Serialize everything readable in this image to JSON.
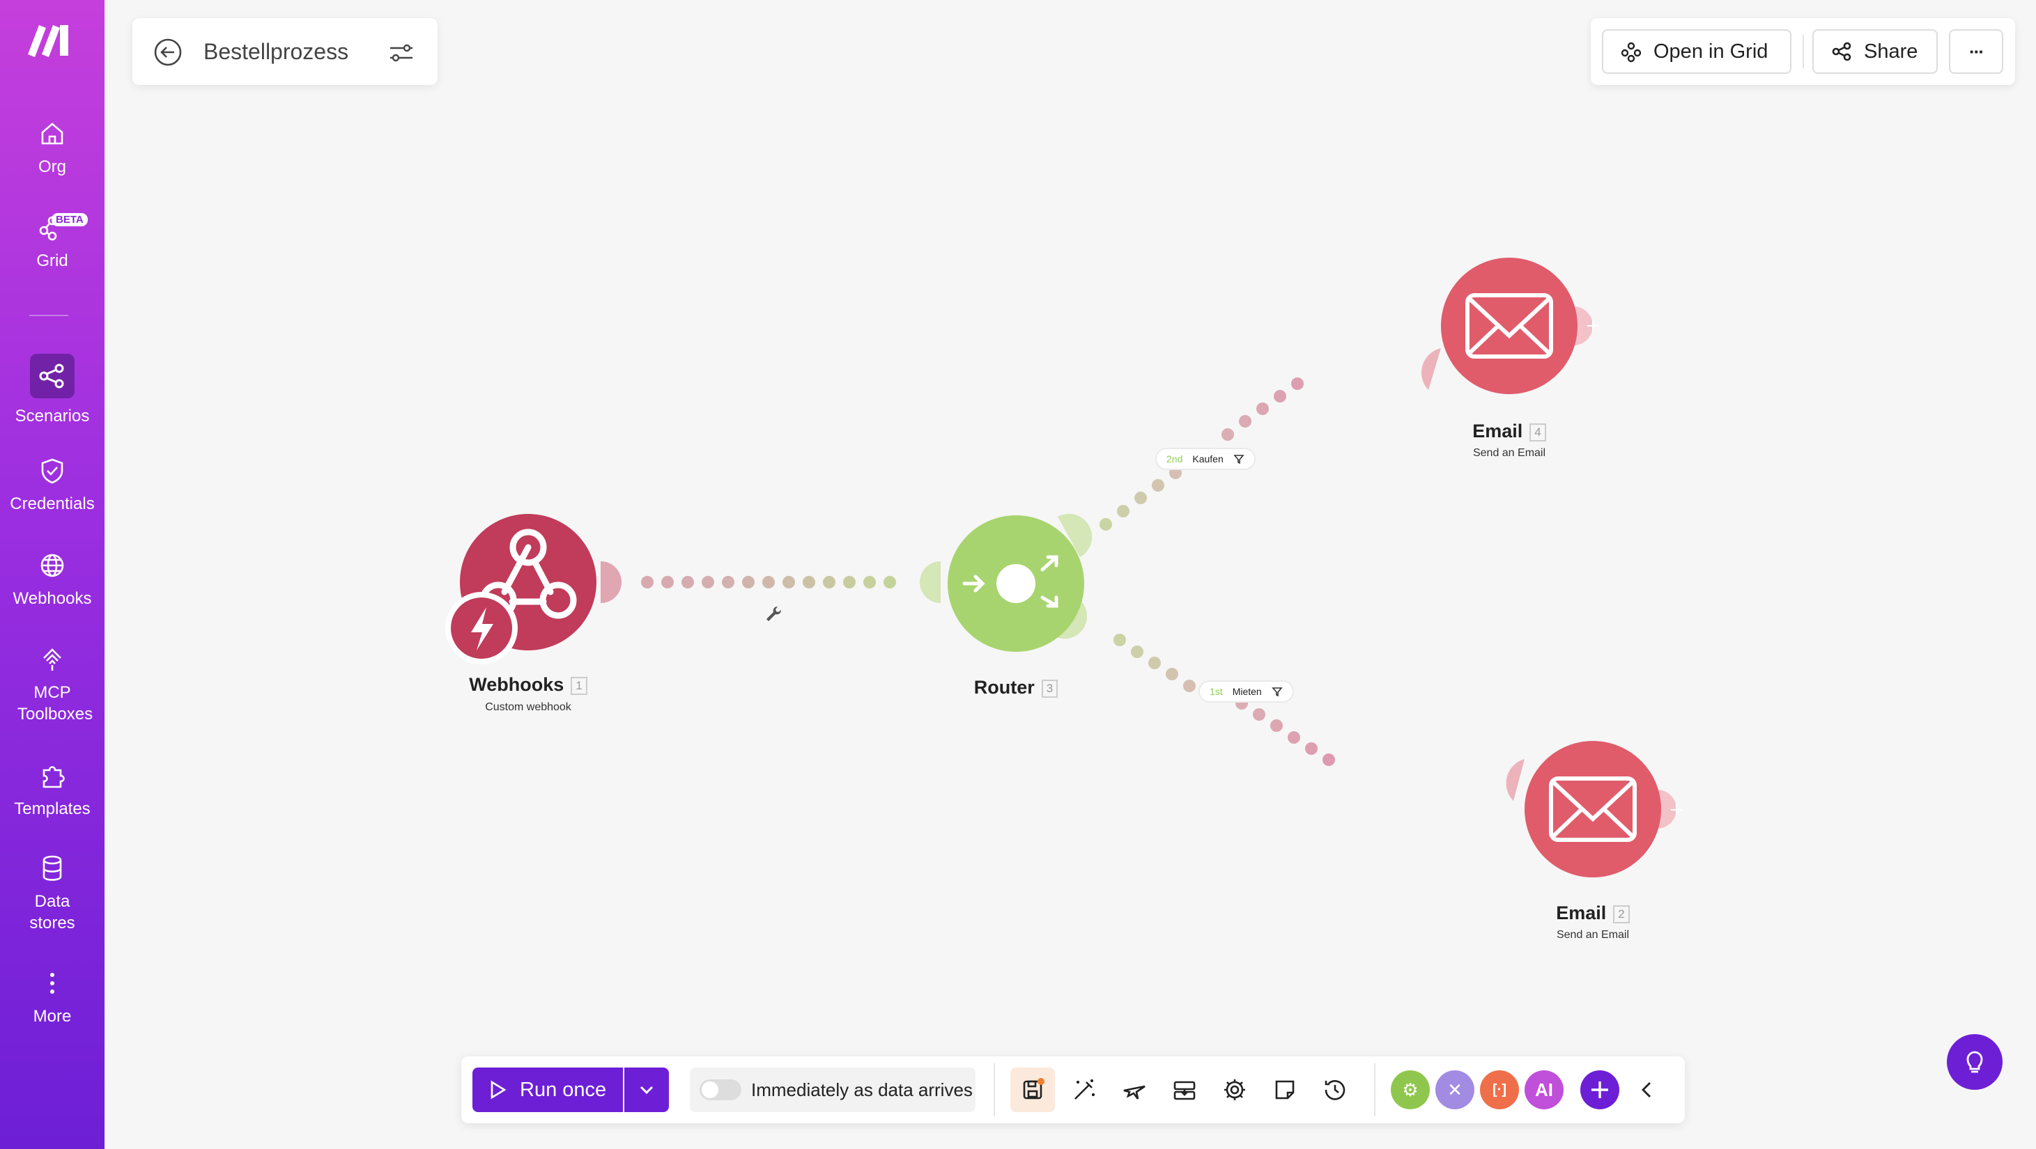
{
  "sidebar": {
    "items": [
      {
        "label": "Org",
        "icon": "home-icon"
      },
      {
        "label": "Grid",
        "icon": "grid-icon",
        "badge": "BETA"
      },
      {
        "label": "Scenarios",
        "icon": "scenarios-icon",
        "active": true
      },
      {
        "label": "Credentials",
        "icon": "shield-icon"
      },
      {
        "label": "Webhooks",
        "icon": "globe-icon"
      },
      {
        "label": "MCP Toolboxes",
        "icon": "toolbox-icon"
      },
      {
        "label": "Templates",
        "icon": "puzzle-icon"
      },
      {
        "label": "Data stores",
        "icon": "database-icon"
      },
      {
        "label": "More",
        "icon": "more-vertical-icon"
      }
    ]
  },
  "header": {
    "scenario_name": "Bestellprozess",
    "open_in_grid": "Open in Grid",
    "share": "Share",
    "more": "···"
  },
  "modules": [
    {
      "name": "Webhooks",
      "index": "1",
      "subtitle": "Custom webhook",
      "color": "#c13b5a"
    },
    {
      "name": "Router",
      "index": "3",
      "subtitle": "",
      "color": "#a8d46f"
    },
    {
      "name": "Email",
      "index": "4",
      "subtitle": "Send an Email",
      "color": "#e05c6b"
    },
    {
      "name": "Email",
      "index": "2",
      "subtitle": "Send an Email",
      "color": "#e05c6b"
    }
  ],
  "filters": [
    {
      "order": "2nd",
      "name": "Kaufen"
    },
    {
      "order": "1st",
      "name": "Mieten"
    }
  ],
  "toolbar": {
    "run_once": "Run once",
    "schedule": "Immediately as data arrives",
    "apps": [
      {
        "label": "⚙",
        "color": "#8fc74e",
        "icon": "gear-app-icon"
      },
      {
        "label": "✕",
        "color": "#a28be3",
        "icon": "tools-app-icon"
      },
      {
        "label": "[·]",
        "color": "#ef6f4a",
        "icon": "text-parser-app-icon"
      },
      {
        "label": "AI",
        "color": "#c04fd9",
        "icon": "ai-app-icon"
      }
    ]
  },
  "colors": {
    "brand": "#6d1fd6",
    "sidebar_top": "#c53fdc",
    "webhook": "#c13b5a",
    "router": "#a8d46f",
    "email": "#e05c6b"
  }
}
